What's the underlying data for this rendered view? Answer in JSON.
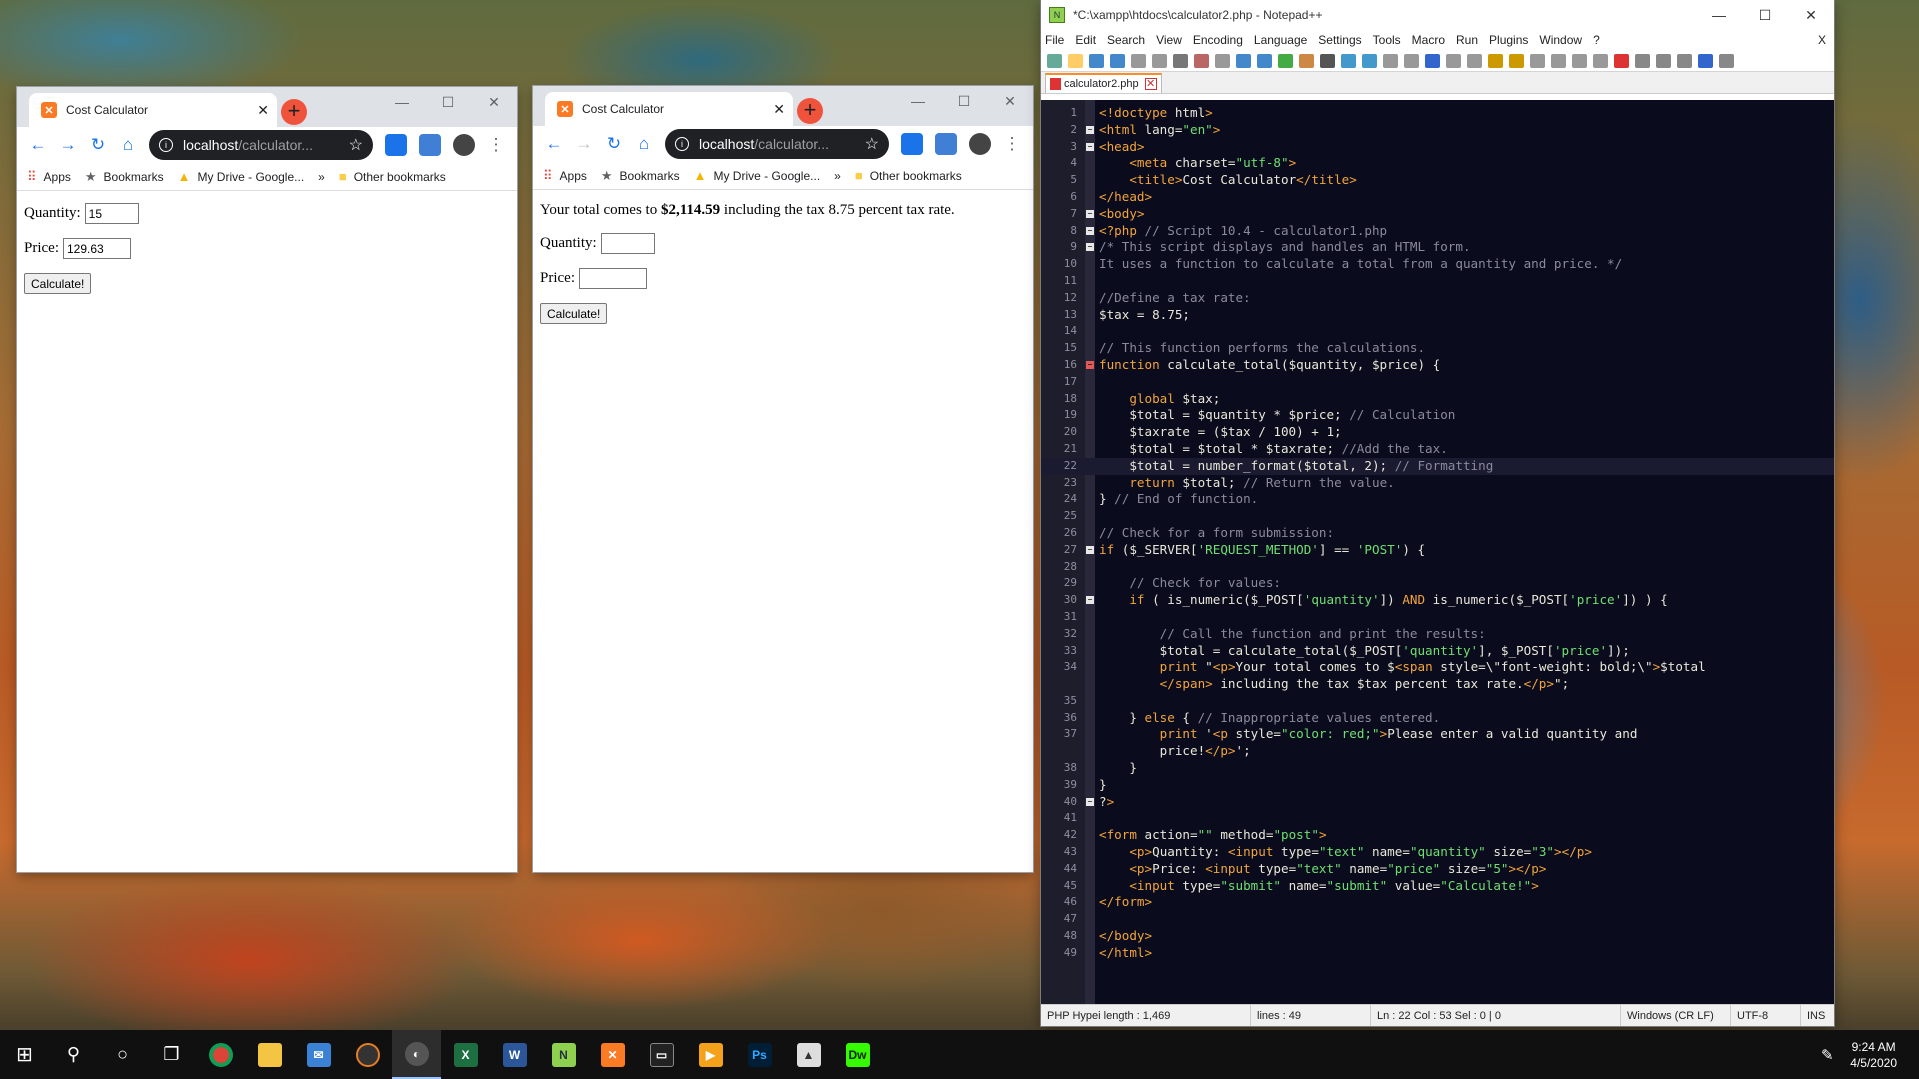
{
  "colors": {
    "chrome_active_tab": "#ffffff",
    "chrome_strip": "#dee1e6",
    "new_tab_btn": "#f0533b",
    "npp_bg": "#0b0b1e",
    "npp_tag": "#f2a53a",
    "npp_string": "#6ee070",
    "npp_comment": "#8a8a9c"
  },
  "browser_left": {
    "tab_title": "Cost Calculator",
    "url_host": "localhost",
    "url_path": "/calculator...",
    "bookmarks": {
      "apps": "Apps",
      "bookmarks": "Bookmarks",
      "drive": "My Drive - Google...",
      "more": "»",
      "other": "Other bookmarks"
    },
    "form": {
      "quantity_label": "Quantity:",
      "quantity_value": "15",
      "price_label": "Price:",
      "price_value": "129.63",
      "submit": "Calculate!"
    }
  },
  "browser_right": {
    "tab_title": "Cost Calculator",
    "url_host": "localhost",
    "url_path": "/calculator...",
    "bookmarks": {
      "apps": "Apps",
      "bookmarks": "Bookmarks",
      "drive": "My Drive - Google...",
      "more": "»",
      "other": "Other bookmarks"
    },
    "result": {
      "prefix": "Your total comes to ",
      "total": "$2,114.59",
      "middle": " including the tax ",
      "rate": "8.75",
      "suffix": " percent tax rate."
    },
    "form": {
      "quantity_label": "Quantity:",
      "quantity_value": "",
      "price_label": "Price:",
      "price_value": "",
      "submit": "Calculate!"
    }
  },
  "notepad": {
    "title": "*C:\\xampp\\htdocs\\calculator2.php - Notepad++",
    "menu": [
      "File",
      "Edit",
      "Search",
      "View",
      "Encoding",
      "Language",
      "Settings",
      "Tools",
      "Macro",
      "Run",
      "Plugins",
      "Window",
      "?"
    ],
    "menu_close": "X",
    "tab": "calculator2.php",
    "current_line": 22,
    "lines": [
      "<!doctype html>",
      "<html lang=\"en\">",
      "<head>",
      "    <meta charset=\"utf-8\">",
      "    <title>Cost Calculator</title>",
      "</head>",
      "<body>",
      "<?php // Script 10.4 - calculator1.php",
      "/* This script displays and handles an HTML form.",
      "It uses a function to calculate a total from a quantity and price. */",
      "",
      "//Define a tax rate:",
      "$tax = 8.75;",
      "",
      "// This function performs the calculations.",
      "function calculate_total($quantity, $price) {",
      "",
      "    global $tax;",
      "    $total = $quantity * $price; // Calculation",
      "    $taxrate = ($tax / 100) + 1;",
      "    $total = $total * $taxrate; //Add the tax.",
      "    $total = number_format($total, 2); // Formatting",
      "    return $total; // Return the value.",
      "} // End of function.",
      "",
      "// Check for a form submission:",
      "if ($_SERVER['REQUEST_METHOD'] == 'POST') {",
      "",
      "    // Check for values:",
      "    if ( is_numeric($_POST['quantity']) AND is_numeric($_POST['price']) ) {",
      "",
      "        // Call the function and print the results:",
      "        $total = calculate_total($_POST['quantity'], $_POST['price']);",
      "        print \"<p>Your total comes to $<span style=\\\"font-weight: bold;\\\">$total",
      "        </span> including the tax $tax percent tax rate.</p>\";",
      "",
      "    } else { // Inappropriate values entered.",
      "        print '<p style=\"color: red;\">Please enter a valid quantity and",
      "        price!</p>';",
      "    }",
      "}",
      "?>",
      "",
      "<form action=\"\" method=\"post\">",
      "    <p>Quantity: <input type=\"text\" name=\"quantity\" size=\"3\"></p>",
      "    <p>Price: <input type=\"text\" name=\"price\" size=\"5\"></p>",
      "    <input type=\"submit\" name=\"submit\" value=\"Calculate!\">",
      "</form>",
      "",
      "</body>",
      "</html>"
    ],
    "line_numbers": [
      "1",
      "2",
      "3",
      "4",
      "5",
      "6",
      "7",
      "8",
      "9",
      "10",
      "11",
      "12",
      "13",
      "14",
      "15",
      "16",
      "17",
      "18",
      "19",
      "20",
      "21",
      "22",
      "23",
      "24",
      "25",
      "26",
      "27",
      "28",
      "29",
      "30",
      "31",
      "32",
      "33",
      "34",
      "",
      "35",
      "36",
      "37",
      "",
      "38",
      "39",
      "40",
      "41",
      "42",
      "43",
      "44",
      "45",
      "46",
      "47",
      "48",
      "49"
    ],
    "status": {
      "type": "PHP Hypei length : 1,469",
      "lines": "lines : 49",
      "pos": "Ln : 22    Col : 53    Sel : 0 | 0",
      "eol": "Windows (CR LF)",
      "enc": "UTF-8",
      "mode": "INS"
    }
  },
  "taskbar": {
    "time": "9:24 AM",
    "date": "4/5/2020"
  }
}
